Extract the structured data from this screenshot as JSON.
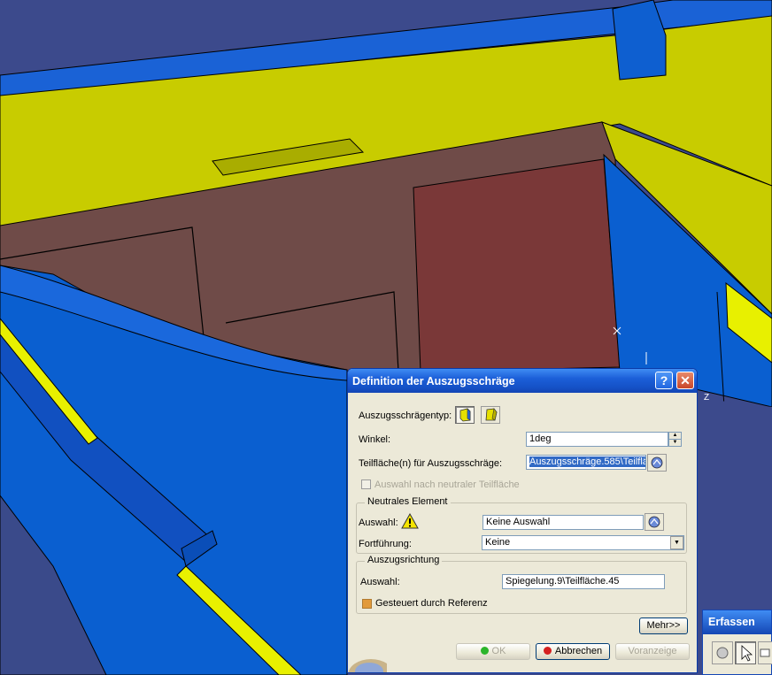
{
  "dialog": {
    "title": "Definition der Auszugsschräge",
    "help_label": "?",
    "close_label": "✕",
    "draft_type_label": "Auszugsschrägentyp:",
    "angle_label": "Winkel:",
    "angle_value": "1deg",
    "faces_label": "Teilfläche(n) für Auszugsschräge:",
    "faces_value": "Auszugsschräge.585\\Teilflä",
    "neutral_select_label": "Auswahl nach neutraler Teilfläche",
    "neutral_group_title": "Neutrales Element",
    "neutral_selection_label": "Auswahl:",
    "neutral_selection_value": "Keine Auswahl",
    "propagation_label": "Fortführung:",
    "propagation_value": "Keine",
    "direction_group_title": "Auszugsrichtung",
    "direction_selection_label": "Auswahl:",
    "direction_selection_value": "Spiegelung.9\\Teilfläche.45",
    "controlled_label": "Gesteuert durch Referenz",
    "more_label": "Mehr>>",
    "ok_label": "OK",
    "cancel_label": "Abbrechen",
    "preview_label": "Voranzeige"
  },
  "viewport": {
    "axis_label": "Z"
  },
  "erfassen": {
    "title": "Erfassen"
  },
  "colors": {
    "yellow": "#c7cc00",
    "bright_yellow": "#e8f000",
    "blue": "#0a5fd0",
    "brown": "#6e4a47",
    "dark_red": "#7a3838"
  }
}
